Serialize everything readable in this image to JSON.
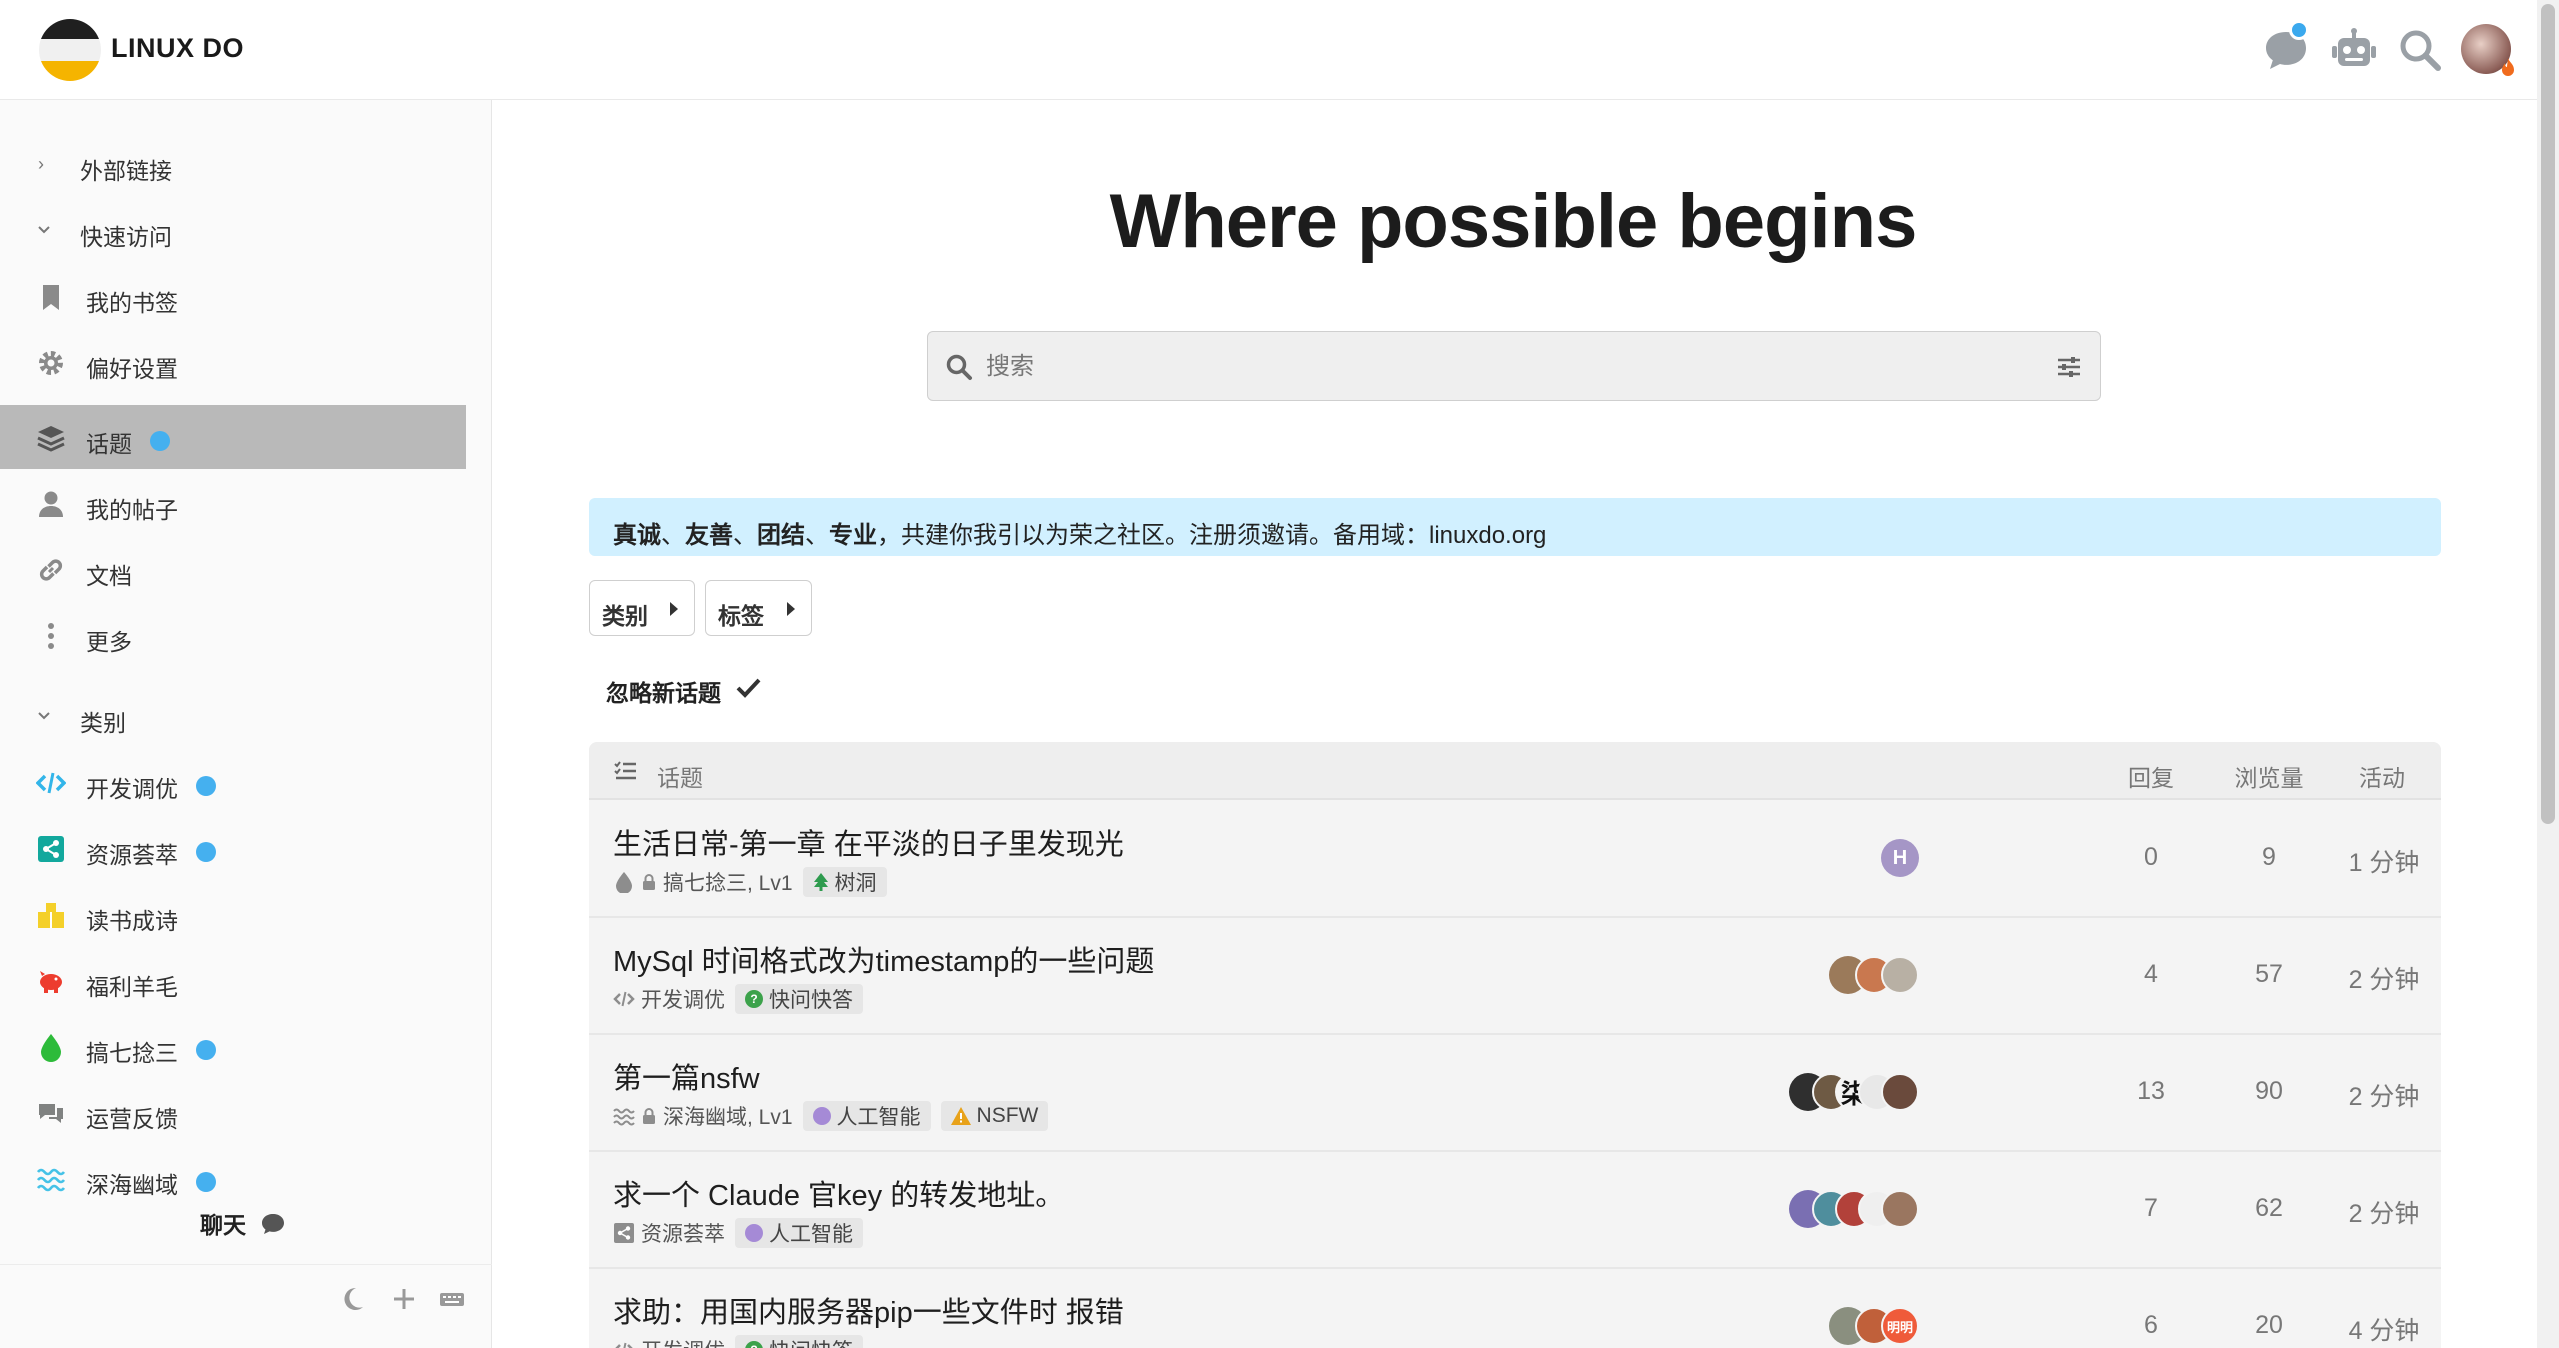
{
  "header": {
    "site_name": "LINUX DO",
    "icons": [
      "chat-icon",
      "robot-icon",
      "search-icon",
      "user-avatar"
    ],
    "accent": "#3ba9ee"
  },
  "sidebar": {
    "sections": [
      {
        "label": "外部链接",
        "state": "collapsed"
      },
      {
        "label": "快速访问",
        "state": "expanded"
      }
    ],
    "quick_items": [
      {
        "label": "我的书签",
        "icon": "bookmark-icon"
      },
      {
        "label": "偏好设置",
        "icon": "gear-icon"
      }
    ],
    "nav_items": [
      {
        "label": "话题",
        "icon": "layers-icon",
        "active": true,
        "dot": true
      },
      {
        "label": "我的帖子",
        "icon": "user-icon"
      },
      {
        "label": "文档",
        "icon": "link-icon"
      },
      {
        "label": "更多",
        "icon": "more-vertical-icon"
      }
    ],
    "categories_title": "类别",
    "categories": [
      {
        "label": "开发调优",
        "icon": "code-icon",
        "color": "#32b5e9",
        "dot": true
      },
      {
        "label": "资源荟萃",
        "icon": "share-icon",
        "color": "#12a89d",
        "dot": true
      },
      {
        "label": "读书成诗",
        "icon": "book-icon",
        "color": "#f4d02a",
        "dot": false
      },
      {
        "label": "福利羊毛",
        "icon": "piggy-bank-icon",
        "color": "#ed3c2e",
        "dot": false
      },
      {
        "label": "搞七捻三",
        "icon": "droplet-icon",
        "color": "#2dbb3a",
        "dot": true
      },
      {
        "label": "运营反馈",
        "icon": "comments-icon",
        "color": "#808281",
        "dot": false
      },
      {
        "label": "深海幽域",
        "icon": "water-icon",
        "color": "#45c2e7",
        "dot": true
      }
    ],
    "chat_label": "聊天"
  },
  "main": {
    "hero_title": "Where possible begins",
    "search": {
      "placeholder": "搜索"
    },
    "banner": {
      "bold_words": [
        "真诚",
        "友善",
        "团结",
        "专业"
      ],
      "separator": "、",
      "rest": "，共建你我引以为荣之社区。注册须邀请。备用域：linuxdo.org"
    },
    "filters": [
      {
        "label": "类别"
      },
      {
        "label": "标签"
      }
    ],
    "dismiss_label": "忽略新话题",
    "table": {
      "headers": {
        "topic": "话题",
        "replies": "回复",
        "views": "浏览量",
        "activity": "活动"
      },
      "rows": [
        {
          "title": "生活日常-第一章 在平淡的日子里发现光",
          "category": "搞七捻三, Lv1",
          "category_icon": "droplet-icon",
          "category_color": "#8d8d8d",
          "locked": true,
          "tags": [
            {
              "label": "树洞",
              "icon": "tree-icon",
              "color": "#2e9b4e"
            }
          ],
          "posters": [
            {
              "letter": "H",
              "color": "#a596c6"
            }
          ],
          "replies": "0",
          "views": "9",
          "activity": "1 分钟"
        },
        {
          "title": "MySql 时间格式改为timestamp的一些问题",
          "category": "开发调优",
          "category_icon": "code-icon",
          "category_color": "#8d8d8d",
          "locked": false,
          "tags": [
            {
              "label": "快问快答",
              "icon": "question-icon",
              "color": "#3ca24b"
            }
          ],
          "posters": [
            {
              "letter": "",
              "color": "#9b7a5a"
            },
            {
              "letter": "",
              "color": "#c9784f"
            },
            {
              "letter": "",
              "color": "#b8b0a4"
            }
          ],
          "replies": "4",
          "views": "57",
          "activity": "2 分钟"
        },
        {
          "title": "第一篇nsfw",
          "category": "深海幽域, Lv1",
          "category_icon": "water-icon",
          "category_color": "#8d8d8d",
          "locked": true,
          "tags": [
            {
              "label": "人工智能",
              "icon": "brain-icon",
              "color": "#a58ad6"
            },
            {
              "label": "NSFW",
              "icon": "warning-icon",
              "color": "#e8a21a"
            }
          ],
          "posters": [
            {
              "letter": "",
              "color": "#2f2f2f"
            },
            {
              "letter": "",
              "color": "#6e5a44"
            },
            {
              "letter": "柒",
              "color": "#111111"
            },
            {
              "letter": "",
              "color": "#e8e8e8"
            },
            {
              "letter": "",
              "color": "#6a4a3c"
            }
          ],
          "replies": "13",
          "views": "90",
          "activity": "2 分钟"
        },
        {
          "title": "求一个 Claude 官key 的转发地址。",
          "category": "资源荟萃",
          "category_icon": "share-icon",
          "category_color": "#8d8d8d",
          "locked": false,
          "tags": [
            {
              "label": "人工智能",
              "icon": "brain-icon",
              "color": "#a58ad6"
            }
          ],
          "posters": [
            {
              "letter": "",
              "color": "#7a6fb2"
            },
            {
              "letter": "",
              "color": "#4f8e9d"
            },
            {
              "letter": "",
              "color": "#b2413a"
            },
            {
              "letter": "",
              "color": "#efefef"
            },
            {
              "letter": "",
              "color": "#9a7660"
            }
          ],
          "replies": "7",
          "views": "62",
          "activity": "2 分钟"
        },
        {
          "title": "求助：用国内服务器pip一些文件时 报错",
          "category": "开发调优",
          "category_icon": "code-icon",
          "category_color": "#8d8d8d",
          "locked": false,
          "tags": [
            {
              "label": "快问快答",
              "icon": "question-icon",
              "color": "#3ca24b"
            }
          ],
          "posters": [
            {
              "letter": "",
              "color": "#8a8f7f"
            },
            {
              "letter": "",
              "color": "#c0603a"
            },
            {
              "letter": "明明",
              "color": "#ef5b3a"
            }
          ],
          "replies": "6",
          "views": "20",
          "activity": "4 分钟"
        }
      ]
    }
  }
}
